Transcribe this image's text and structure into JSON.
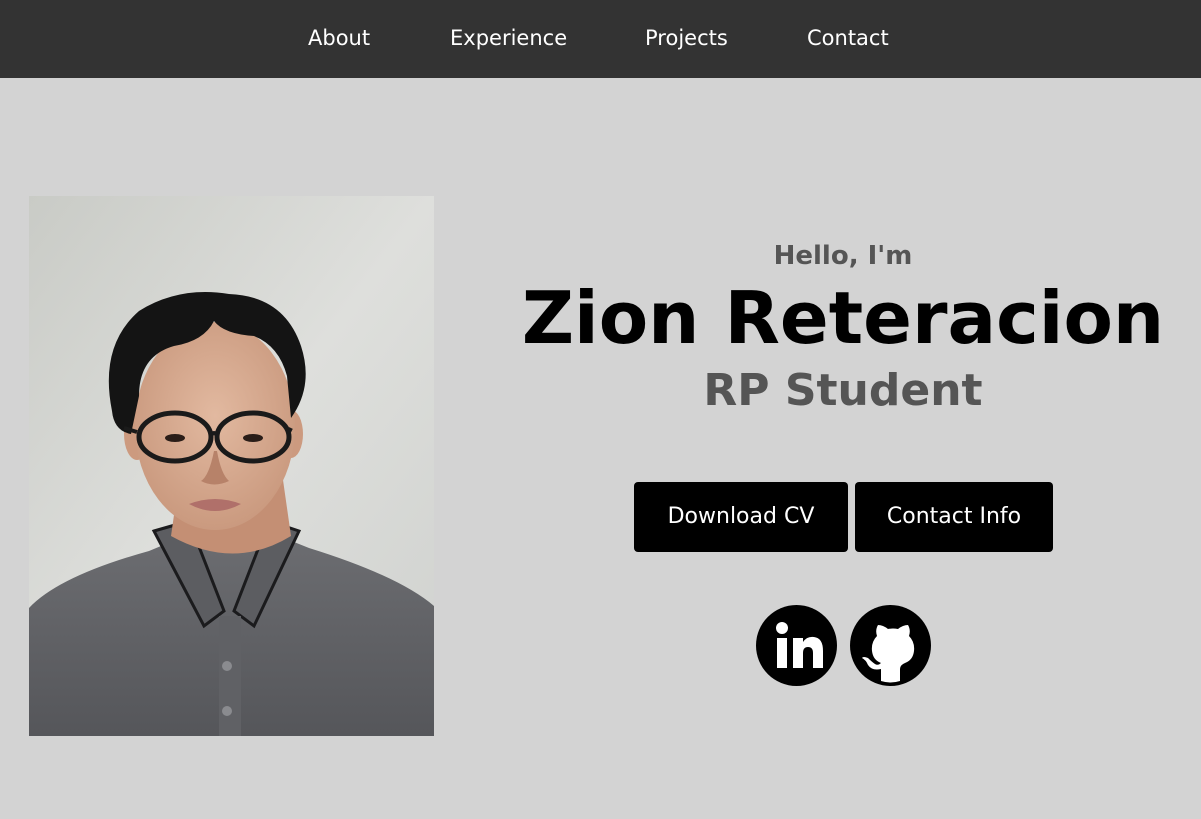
{
  "nav": {
    "items": [
      {
        "label": "About"
      },
      {
        "label": "Experience"
      },
      {
        "label": "Projects"
      },
      {
        "label": "Contact"
      }
    ]
  },
  "hero": {
    "greeting": "Hello, I'm",
    "name": "Zion Reteracion",
    "role": "RP Student",
    "buttons": {
      "download_cv": "Download CV",
      "contact_info": "Contact Info"
    },
    "social": [
      {
        "icon": "linkedin-icon"
      },
      {
        "icon": "github-icon"
      }
    ]
  },
  "colors": {
    "navbar_bg": "#333333",
    "page_bg": "#d3d3d3",
    "button_bg": "#000000",
    "subtitle": "#555555"
  }
}
